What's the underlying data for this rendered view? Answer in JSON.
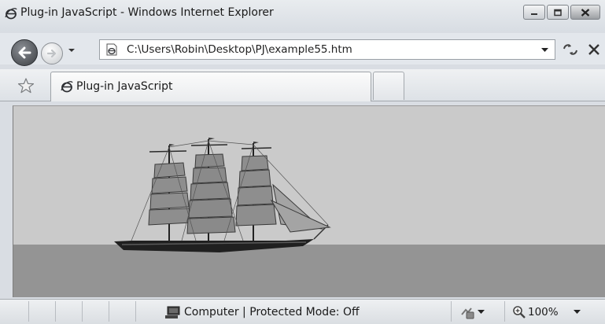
{
  "window": {
    "title": "Plug-in JavaScript - Windows Internet Explorer",
    "app_icon": "ie-icon",
    "controls": [
      "minimize-icon",
      "maximize-icon",
      "close-icon"
    ]
  },
  "navigation": {
    "back_icon": "back-arrow-icon",
    "forward_icon": "forward-arrow-icon",
    "recent_pages_icon": "chevron-down-icon",
    "address": "C:\\Users\\Robin\\Desktop\\PJ\\example55.htm",
    "refresh_icon": "refresh-icon",
    "stop_icon": "stop-icon"
  },
  "tabs": {
    "favorites_icon": "star-icon",
    "items": [
      {
        "label": "Plug-in JavaScript",
        "icon": "ie-icon"
      }
    ]
  },
  "content": {
    "image": "tall-ship-sailing-on-sea",
    "colors": {
      "sky": "#cacaca",
      "sea": "#949494"
    }
  },
  "statusbar": {
    "zone": "Computer | Protected Mode: Off",
    "zone_icon": "computer-icon",
    "addons_icon": "manage-addons-icon",
    "zoom": "100%",
    "zoom_icon": "magnifier-icon"
  }
}
